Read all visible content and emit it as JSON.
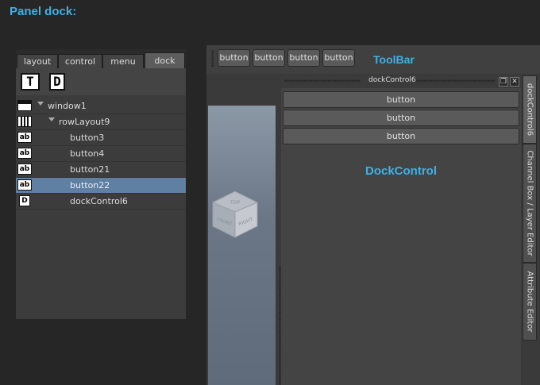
{
  "page": {
    "title": "Panel dock:"
  },
  "left_panel": {
    "tabs": [
      {
        "label": "layout"
      },
      {
        "label": "control"
      },
      {
        "label": "menu"
      },
      {
        "label": "dock",
        "active": true
      }
    ],
    "toolbar_icons": [
      {
        "glyph": "T",
        "icon": "text-icon"
      },
      {
        "glyph": "D",
        "icon": "dock-icon"
      }
    ],
    "tree": [
      {
        "label": "window1",
        "icon": "window-icon"
      },
      {
        "label": "rowLayout9",
        "icon": "row-layout-icon"
      },
      {
        "label": "button3",
        "icon": "button-icon",
        "icon_text": "ab"
      },
      {
        "label": "button4",
        "icon": "button-icon",
        "icon_text": "ab"
      },
      {
        "label": "button21",
        "icon": "button-icon",
        "icon_text": "ab"
      },
      {
        "label": "button22",
        "icon": "button-icon",
        "icon_text": "ab",
        "selected": true
      },
      {
        "label": "dockControl6",
        "icon": "dock-icon",
        "icon_text": "D"
      }
    ]
  },
  "toolbar": {
    "label": "ToolBar",
    "buttons": [
      "button",
      "button",
      "button",
      "button"
    ]
  },
  "viewport": {
    "cube_faces": [
      "FRONT",
      "RIGHT",
      "TOP"
    ]
  },
  "dock_control": {
    "title": "dockControl6",
    "label": "DockControl",
    "buttons": [
      "button",
      "button",
      "button"
    ]
  },
  "side_tabs": [
    {
      "label": "dockControl6",
      "active": true
    },
    {
      "label": "Channel Box / Layer Editor"
    },
    {
      "label": "Attribute Editor"
    }
  ],
  "colors": {
    "accent": "#3fb0e6",
    "selection": "#5f7fa3"
  }
}
